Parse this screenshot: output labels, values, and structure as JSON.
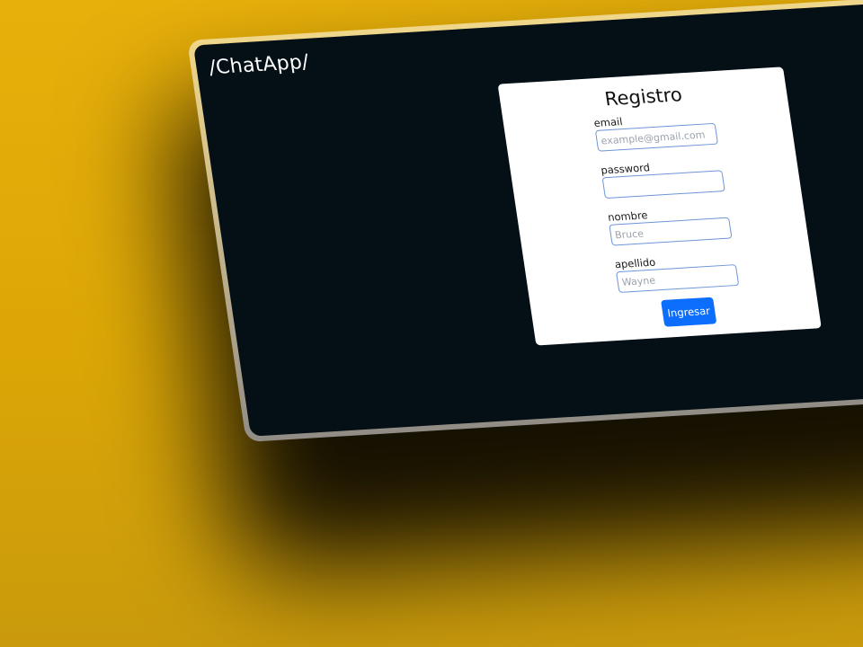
{
  "app": {
    "brand": "/ChatApp/"
  },
  "form": {
    "title": "Registro",
    "fields": [
      {
        "label": "email",
        "placeholder": "example@gmail.com",
        "value": ""
      },
      {
        "label": "password",
        "placeholder": "",
        "value": ""
      },
      {
        "label": "nombre",
        "placeholder": "Bruce",
        "value": ""
      },
      {
        "label": "apellido",
        "placeholder": "Wayne",
        "value": ""
      }
    ],
    "submit_label": "Ingresar"
  },
  "colors": {
    "background": "#e8b00a",
    "screen": "#040f16",
    "card": "#ffffff",
    "accent": "#0d6efd",
    "input_border": "#6d95d8"
  }
}
